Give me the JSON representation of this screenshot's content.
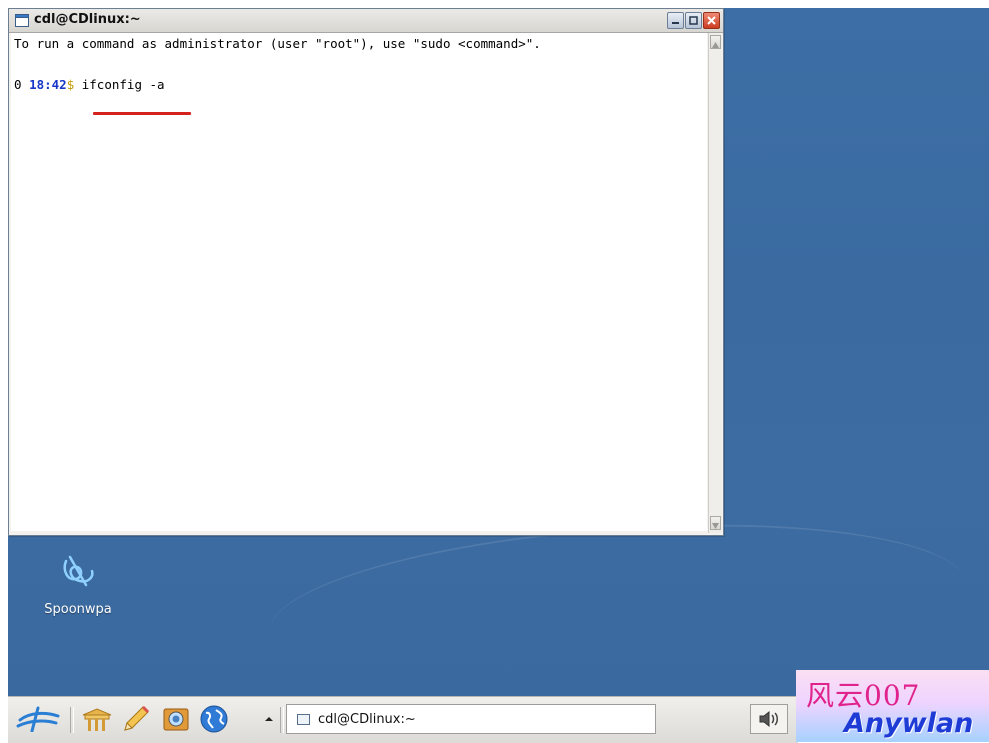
{
  "window": {
    "title": "cdl@CDlinux:~",
    "controls": [
      "minimize",
      "maximize",
      "close"
    ]
  },
  "terminal": {
    "line1": "To run a command as administrator (user \"root\"), use \"sudo <command>\".",
    "prompt_status": "0 ",
    "prompt_time": "18:42",
    "prompt_symbol": "$",
    "command": " ifconfig -a",
    "highlight_color": "#d6221c"
  },
  "desktop": {
    "icon_label": "Spoonwpa",
    "background_color": "#3b6ba1"
  },
  "taskbar": {
    "launchers": [
      "menu-icon",
      "file-manager-icon",
      "text-editor-icon",
      "screenshot-icon",
      "browser-icon",
      "chevron-up-icon"
    ],
    "task_label": "cdl@CDlinux:~",
    "tray": [
      "speaker-icon"
    ]
  },
  "watermark": {
    "line1": "风云007",
    "line2": "Anywlan"
  }
}
